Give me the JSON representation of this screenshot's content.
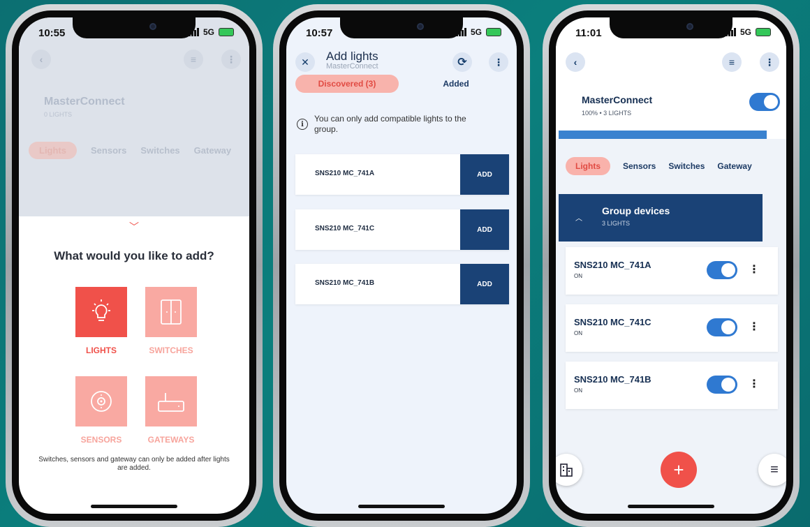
{
  "phone1": {
    "status": {
      "time": "10:55",
      "network": "5G"
    },
    "bg_title": "MasterConnect",
    "bg_subtitle": "0 LIGHTS",
    "bg_tabs": [
      "Lights",
      "Sensors",
      "Switches",
      "Gateway"
    ],
    "question": "What would you like to add?",
    "options": [
      {
        "label": "LIGHTS",
        "icon": "lightbulb-icon",
        "enabled": true
      },
      {
        "label": "SWITCHES",
        "icon": "switch-icon",
        "enabled": false
      },
      {
        "label": "SENSORS",
        "icon": "sensor-icon",
        "enabled": false
      },
      {
        "label": "GATEWAYS",
        "icon": "gateway-icon",
        "enabled": false
      }
    ],
    "note": "Switches, sensors and gateway can only be added after lights are added."
  },
  "phone2": {
    "status": {
      "time": "10:57",
      "network": "5G"
    },
    "title": "Add lights",
    "subtitle": "MasterConnect",
    "tabs": {
      "discovered": "Discovered (3)",
      "added": "Added"
    },
    "info": "You can only add compatible lights to the group.",
    "devices": [
      {
        "name": "SNS210 MC_741A",
        "action": "ADD"
      },
      {
        "name": "SNS210 MC_741C",
        "action": "ADD"
      },
      {
        "name": "SNS210 MC_741B",
        "action": "ADD"
      }
    ]
  },
  "phone3": {
    "status": {
      "time": "11:01",
      "network": "5G"
    },
    "title": "MasterConnect",
    "subtitle": "100% • 3 LIGHTS",
    "tabs": [
      "Lights",
      "Sensors",
      "Switches",
      "Gateway"
    ],
    "group": {
      "title": "Group devices",
      "subtitle": "3 LIGHTS"
    },
    "devices": [
      {
        "name": "SNS210 MC_741A",
        "state": "ON",
        "on": true
      },
      {
        "name": "SNS210 MC_741C",
        "state": "ON",
        "on": true
      },
      {
        "name": "SNS210 MC_741B",
        "state": "ON",
        "on": true
      }
    ],
    "fab_label": "+"
  },
  "colors": {
    "accent_red": "#f0514a",
    "navy": "#1a4276",
    "toggle_blue": "#2f79d1",
    "background_teal": "#0b7f7d"
  }
}
